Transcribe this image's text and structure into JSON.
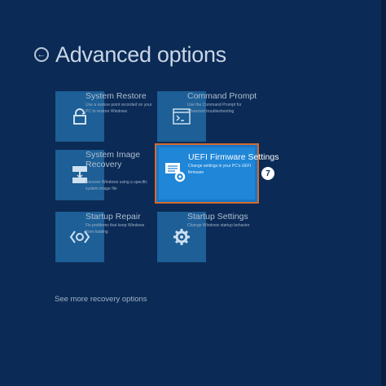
{
  "header": {
    "title": "Advanced options"
  },
  "tiles": [
    {
      "title": "System Restore",
      "desc": "Use a restore point recorded on your PC to restore Windows"
    },
    {
      "title": "Command Prompt",
      "desc": "Use the Command Prompt for advanced troubleshooting"
    },
    {
      "title": "System Image Recovery",
      "desc": "Recover Windows using a specific system image file"
    },
    {
      "title": "UEFI Firmware Settings",
      "desc": "Change settings in your PC's UEFI firmware"
    },
    {
      "title": "Startup Repair",
      "desc": "Fix problems that keep Windows from loading"
    },
    {
      "title": "Startup Settings",
      "desc": "Change Windows startup behavior"
    }
  ],
  "badge": "7",
  "more_link": "See more recovery options",
  "colors": {
    "background": "#0b2a55",
    "tile_icon": "#1d5f96",
    "selected_tile": "#1f86d8",
    "highlight_border": "#d46a2c"
  },
  "icons": [
    "back-arrow-icon",
    "system-restore-icon",
    "command-prompt-icon",
    "system-image-icon",
    "uefi-settings-icon",
    "startup-repair-icon",
    "startup-settings-icon"
  ]
}
